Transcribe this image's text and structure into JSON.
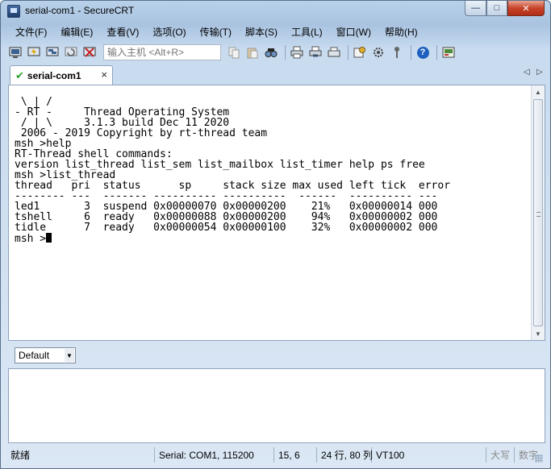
{
  "window": {
    "title": "serial-com1 - SecureCRT",
    "minimize_glyph": "—",
    "maximize_glyph": "□",
    "close_glyph": "✕"
  },
  "menu": {
    "items": [
      "文件(F)",
      "编辑(E)",
      "查看(V)",
      "选项(O)",
      "传输(T)",
      "脚本(S)",
      "工具(L)",
      "窗口(W)",
      "帮助(H)"
    ]
  },
  "toolbar": {
    "quick_connect_placeholder": "输入主机 <Alt+R>",
    "help_glyph": "?",
    "icons": [
      "connect-icon",
      "quick-connect-icon",
      "connect-tab-icon",
      "reconnect-icon",
      "disconnect-icon",
      "copy-icon",
      "paste-icon",
      "find-icon",
      "print-icon",
      "print-selection-icon",
      "printer-icon",
      "session-options-icon",
      "global-options-icon",
      "keymap-icon",
      "help-icon",
      "sftp-icon"
    ]
  },
  "tab": {
    "label": "serial-com1",
    "close_glyph": "×",
    "prev_glyph": "◁",
    "next_glyph": "▷"
  },
  "terminal": {
    "lines": [
      " \\ | /",
      "- RT -     Thread Operating System",
      " / | \\     3.1.3 build Dec 11 2020",
      " 2006 - 2019 Copyright by rt-thread team",
      "msh >help",
      "RT-Thread shell commands:",
      "version list_thread list_sem list_mailbox list_timer help ps free",
      "msh >list_thread",
      "thread   pri  status      sp     stack size max used left tick  error",
      "-------- ---  ------- ---------- ----------  ------  ---------- ---",
      "led1       3  suspend 0x00000070 0x00000200    21%   0x00000014 000",
      "tshell     6  ready   0x00000088 0x00000200    94%   0x00000002 000",
      "tidle      7  ready   0x00000054 0x00000100    32%   0x00000002 000"
    ],
    "prompt": "msh >"
  },
  "chat": {
    "session_selected": "Default"
  },
  "statusbar": {
    "ready": "就绪",
    "serial": "Serial: COM1, 115200",
    "position": "15,   6",
    "size": "24 行, 80 列",
    "terminal_type": "VT100",
    "caps": "大写",
    "num": "数字"
  }
}
